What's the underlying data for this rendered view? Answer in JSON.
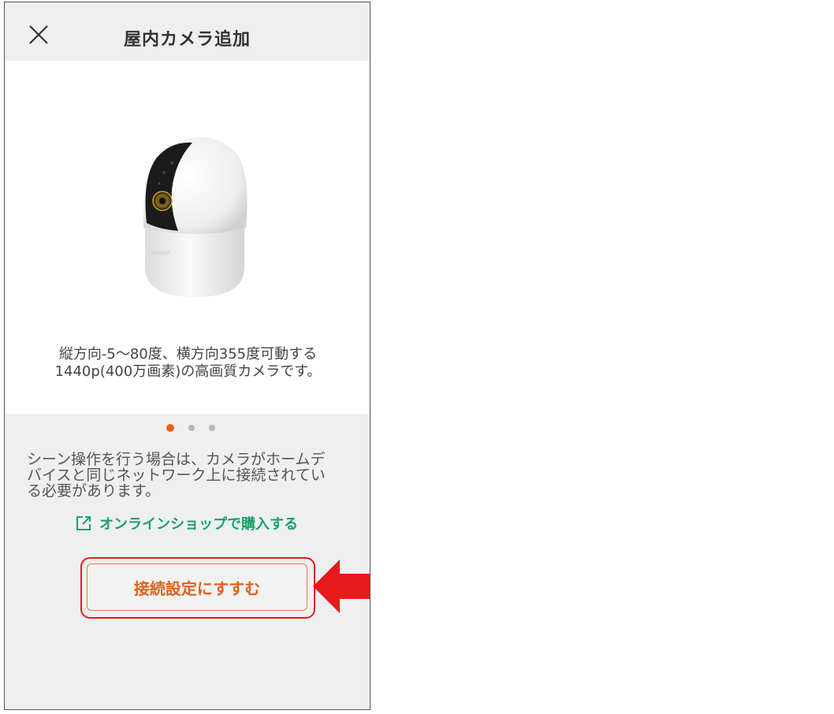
{
  "header": {
    "title": "屋内カメラ追加",
    "close_icon": "close-icon"
  },
  "carousel": {
    "description_line1": "縦方向-5〜80度、横方向355度可動する",
    "description_line2": "1440p(400万画素)の高画質カメラです。",
    "total_slides": 3,
    "active_index": 0,
    "image": "camera-product-image",
    "colors": {
      "dot_active": "#e8631a",
      "dot_inactive": "#b8b8b8"
    }
  },
  "notice": {
    "line1": "シーン操作を行う場合は、カメラがホームデ",
    "line2": "バイスと同じネットワーク上に接続されてい",
    "line3": "る必要があります。"
  },
  "shop_link": {
    "label": "オンラインショップで購入する",
    "icon": "external-link-icon",
    "color": "#1aa26a"
  },
  "primary_action": {
    "label": "接続設定にすすむ",
    "color": "#e35f17"
  },
  "annotation": {
    "highlight_color": "#e8191a",
    "arrow_icon": "left-arrow-icon"
  }
}
